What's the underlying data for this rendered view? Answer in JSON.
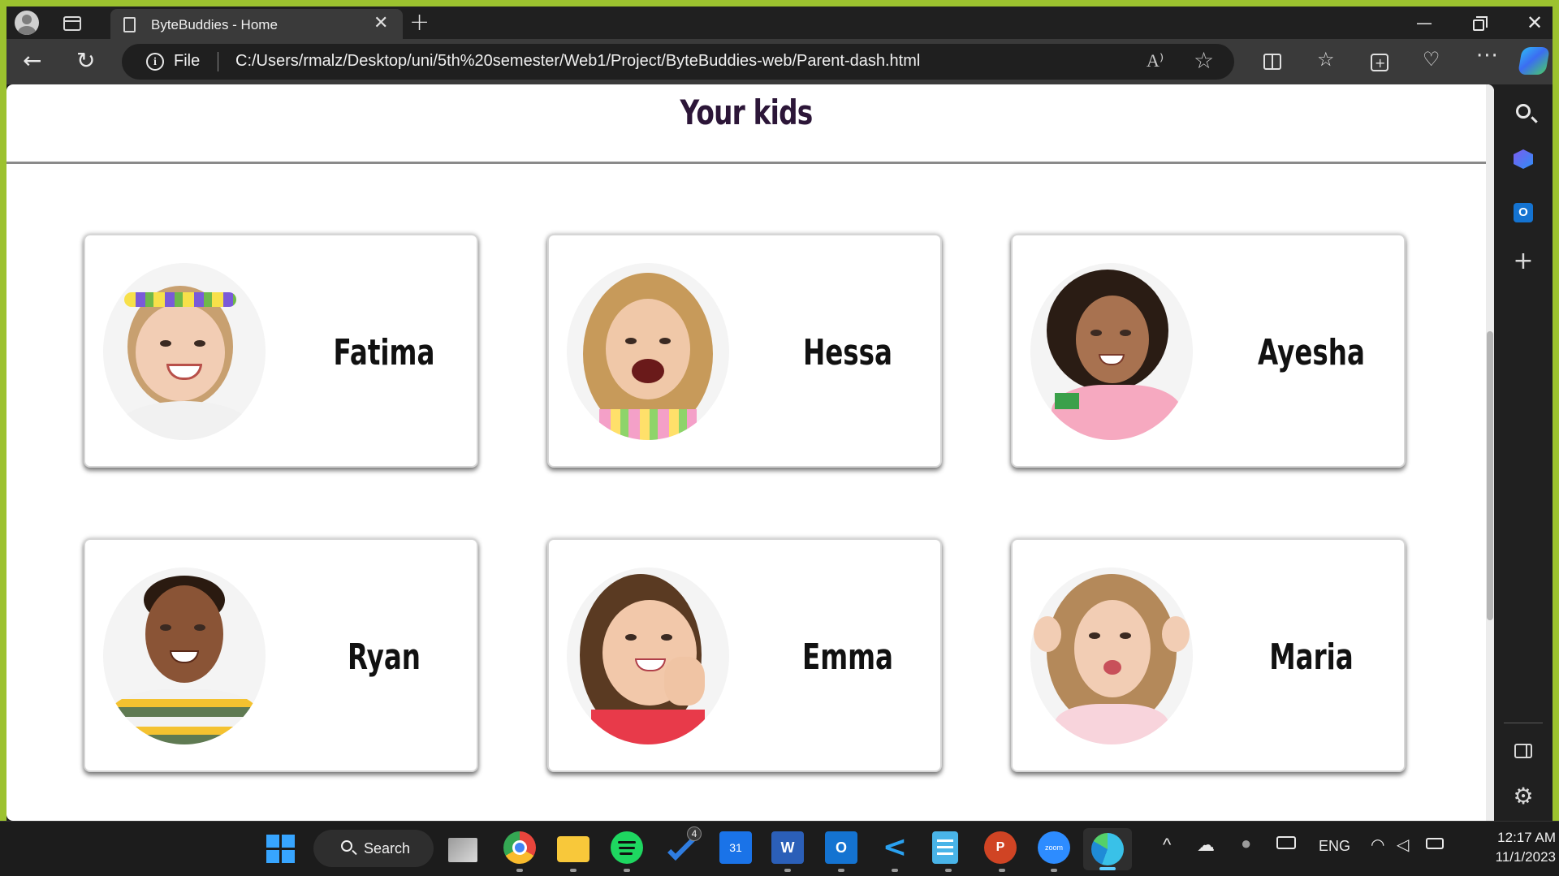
{
  "browser": {
    "tab_title": "ByteBuddies - Home",
    "file_label": "File",
    "url": "C:/Users/rmalz/Desktop/uni/5th%20semester/Web1/Project/ByteBuddies-web/Parent-dash.html"
  },
  "page": {
    "heading": "Your kids",
    "kids": [
      {
        "name": "Fatima"
      },
      {
        "name": "Hessa"
      },
      {
        "name": "Ayesha"
      },
      {
        "name": "Ryan"
      },
      {
        "name": "Emma"
      },
      {
        "name": "Maria"
      }
    ]
  },
  "taskbar": {
    "search_label": "Search",
    "badge_count": "4",
    "calendar_day": "31",
    "language": "ENG",
    "time": "12:17 AM",
    "date": "11/1/2023"
  },
  "colors": {
    "desktop_border": "#9cc22f",
    "heading_text": "#2c1638",
    "browser_chrome": "#202020"
  }
}
